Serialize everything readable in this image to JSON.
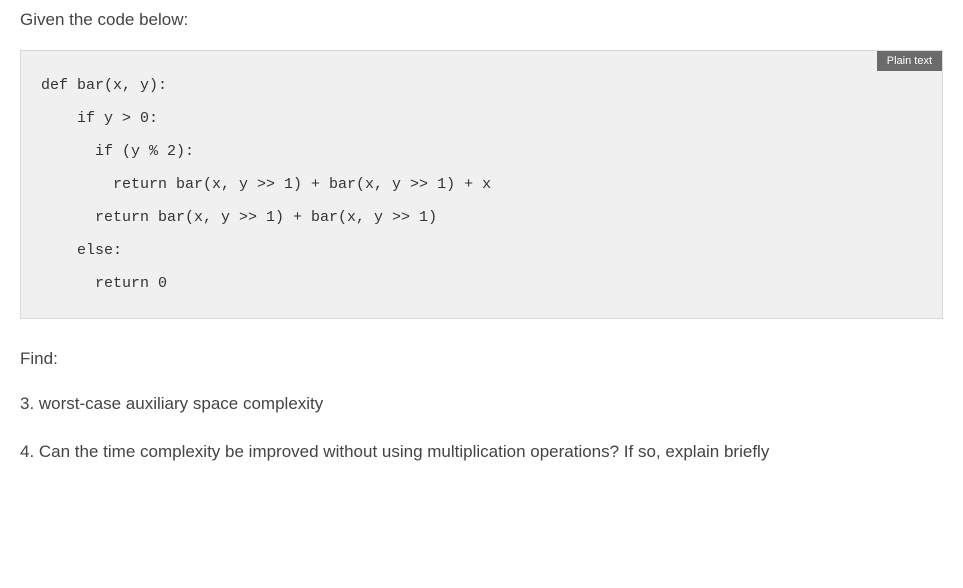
{
  "intro": "Given the code below:",
  "badge": "Plain text",
  "code": "def bar(x, y):\n    if y > 0:\n      if (y % 2):\n        return bar(x, y >> 1) + bar(x, y >> 1) + x\n      return bar(x, y >> 1) + bar(x, y >> 1)\n    else:\n      return 0",
  "find_label": "Find:",
  "questions": {
    "q3": "3. worst-case auxiliary space complexity",
    "q4": "4. Can the time complexity be improved without using multiplication operations? If so, explain briefly"
  }
}
